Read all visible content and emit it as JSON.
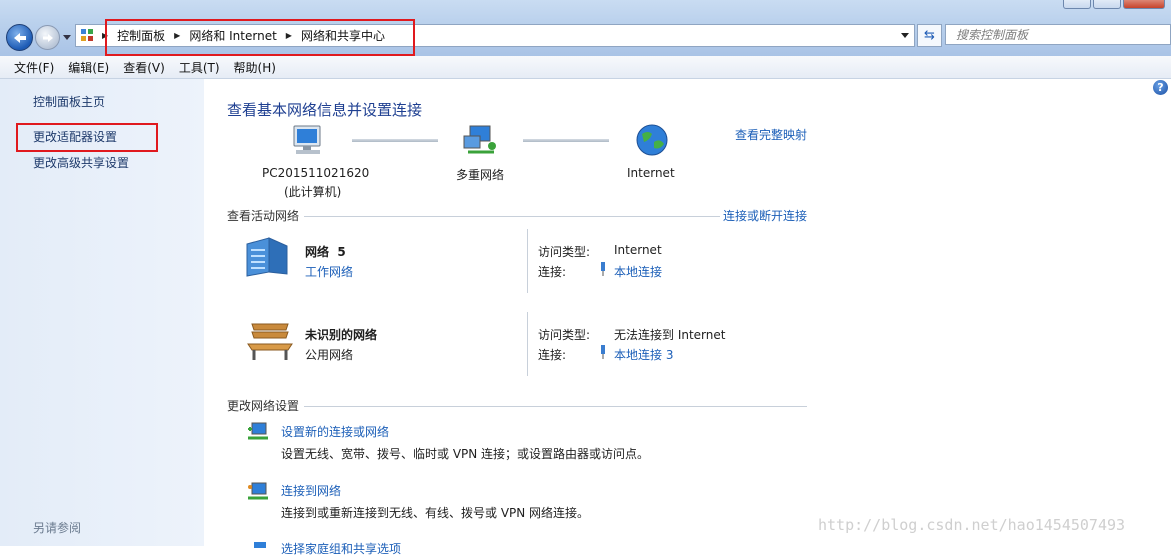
{
  "address_bar": {
    "crumbs": [
      "控制面板",
      "网络和 Internet",
      "网络和共享中心"
    ]
  },
  "search": {
    "placeholder": "搜索控制面板"
  },
  "menu": [
    "文件(F)",
    "编辑(E)",
    "查看(V)",
    "工具(T)",
    "帮助(H)"
  ],
  "sidebar": {
    "items": [
      {
        "label": "控制面板主页"
      },
      {
        "label": "更改适配器设置",
        "highlighted": true
      },
      {
        "label": "更改高级共享设置"
      }
    ],
    "see_also": "另请参阅"
  },
  "main": {
    "title": "查看基本网络信息并设置连接",
    "see_full_map": "查看完整映射",
    "map": {
      "computer_name": "PC201511021620",
      "computer_sub": "(此计算机)",
      "middle": "多重网络",
      "internet": "Internet"
    },
    "active_networks": {
      "heading": "查看活动网络",
      "connect_link": "连接或断开连接",
      "networks": [
        {
          "name": "网络  5",
          "type": "工作网络",
          "access_label": "访问类型:",
          "access": "Internet",
          "conn_label": "连接:",
          "conn": "本地连接",
          "type_is_link": true
        },
        {
          "name": "未识别的网络",
          "type": "公用网络",
          "access_label": "访问类型:",
          "access": "无法连接到 Internet",
          "conn_label": "连接:",
          "conn": "本地连接 3",
          "type_is_link": false
        }
      ]
    },
    "change_settings": {
      "heading": "更改网络设置",
      "tasks": [
        {
          "title": "设置新的连接或网络",
          "desc": "设置无线、宽带、拨号、临时或 VPN 连接；或设置路由器或访问点。"
        },
        {
          "title": "连接到网络",
          "desc": "连接到或重新连接到无线、有线、拨号或 VPN 网络连接。"
        },
        {
          "title": "选择家庭组和共享选项"
        }
      ]
    }
  },
  "watermark": "http://blog.csdn.net/hao1454507493"
}
